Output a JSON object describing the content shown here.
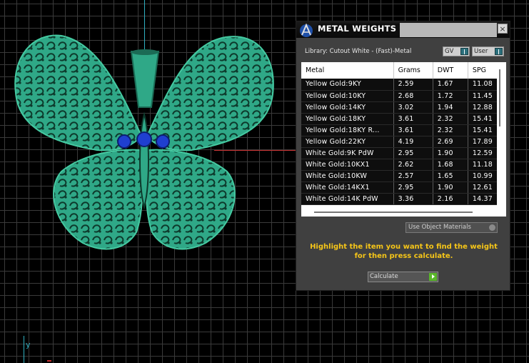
{
  "panel": {
    "title": "METAL WEIGHTS",
    "library_label": "Library: Cutout White - (Fast)-Metal",
    "gv_label": "GV",
    "user_label": "User",
    "close_symbol": "×",
    "columns": [
      "Metal",
      "Grams",
      "DWT",
      "SPG"
    ],
    "rows": [
      [
        "Yellow Gold:9KY",
        "2.59",
        "1.67",
        "11.08"
      ],
      [
        "Yellow Gold:10KY",
        "2.68",
        "1.72",
        "11.45"
      ],
      [
        "Yellow Gold:14KY",
        "3.02",
        "1.94",
        "12.88"
      ],
      [
        "Yellow Gold:18KY",
        "3.61",
        "2.32",
        "15.41"
      ],
      [
        "Yellow Gold:18KY R...",
        "3.61",
        "2.32",
        "15.41"
      ],
      [
        "Yellow Gold:22KY",
        "4.19",
        "2.69",
        "17.89"
      ],
      [
        "White Gold:9K PdW",
        "2.95",
        "1.90",
        "12.59"
      ],
      [
        "White Gold:10KX1",
        "2.62",
        "1.68",
        "11.18"
      ],
      [
        "White Gold:10KW",
        "2.57",
        "1.65",
        "10.99"
      ],
      [
        "White Gold:14KX1",
        "2.95",
        "1.90",
        "12.61"
      ],
      [
        "White Gold:14K PdW",
        "3.36",
        "2.16",
        "14.37"
      ]
    ],
    "materials_dropdown": "Use Object Materials",
    "hint": "Highlight the item you want to find the weight for then press calculate.",
    "calculate_label": "Calculate"
  },
  "viewport": {
    "axis_label": "y"
  },
  "colors": {
    "model": "#2fa887",
    "gem": "#1f3fd0",
    "hint": "#f5c518"
  },
  "icons": [
    "app-logo-icon",
    "close-icon",
    "dropdown-icon",
    "play-arrow-icon"
  ]
}
